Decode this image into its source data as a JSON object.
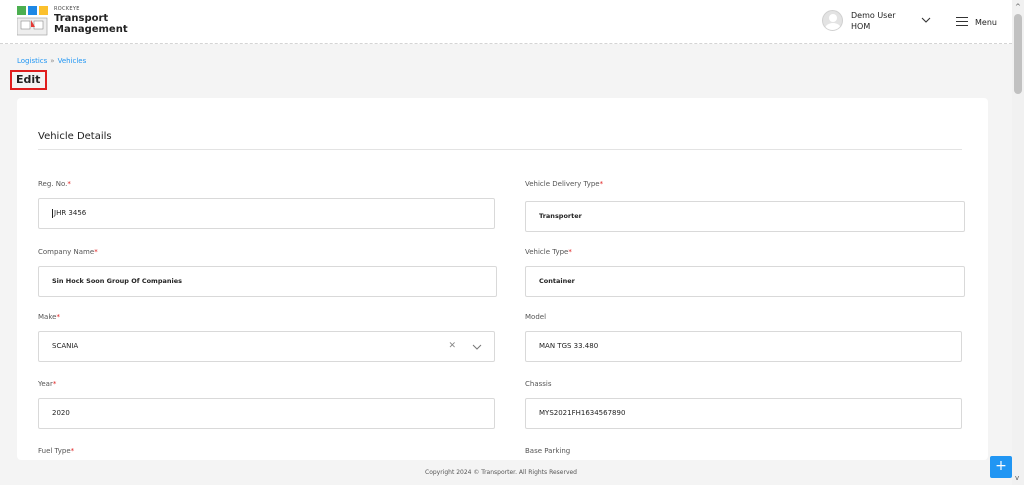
{
  "header": {
    "brand_small": "ROCKEYE",
    "brand_line1": "Transport",
    "brand_line2": "Management",
    "user_name": "Demo User",
    "user_role": "HOM",
    "menu_label": "Menu"
  },
  "breadcrumb": {
    "items": [
      "Logistics",
      "Vehicles"
    ],
    "separator": "»"
  },
  "page_title": "Edit",
  "section_title": "Vehicle Details",
  "fields": {
    "reg_no": {
      "label": "Reg. No.",
      "required": "*",
      "value": "JHR 3456"
    },
    "vehicle_delivery_type": {
      "label": "Vehicle Delivery Type",
      "required": "*",
      "value": "Transporter"
    },
    "company_name": {
      "label": "Company Name",
      "required": "*",
      "value": "Sin Hock Soon Group Of Companies"
    },
    "vehicle_type": {
      "label": "Vehicle Type",
      "required": "*",
      "value": "Container"
    },
    "make": {
      "label": "Make",
      "required": "*",
      "value": "SCANIA"
    },
    "model": {
      "label": "Model",
      "value": "MAN TGS 33.480"
    },
    "year": {
      "label": "Year",
      "required": "*",
      "value": "2020"
    },
    "chassis": {
      "label": "Chassis",
      "value": "MYS2021FH1634567890"
    },
    "fuel_type": {
      "label": "Fuel Type",
      "required": "*"
    },
    "base_parking": {
      "label": "Base Parking"
    }
  },
  "footer": {
    "copyright": "Copyright 2024 © Transporter. All Rights Reserved"
  },
  "fab_label": "+",
  "colors": {
    "accent": "#2196f3",
    "required": "#e01e1e",
    "highlight_border": "#e01e1e"
  }
}
